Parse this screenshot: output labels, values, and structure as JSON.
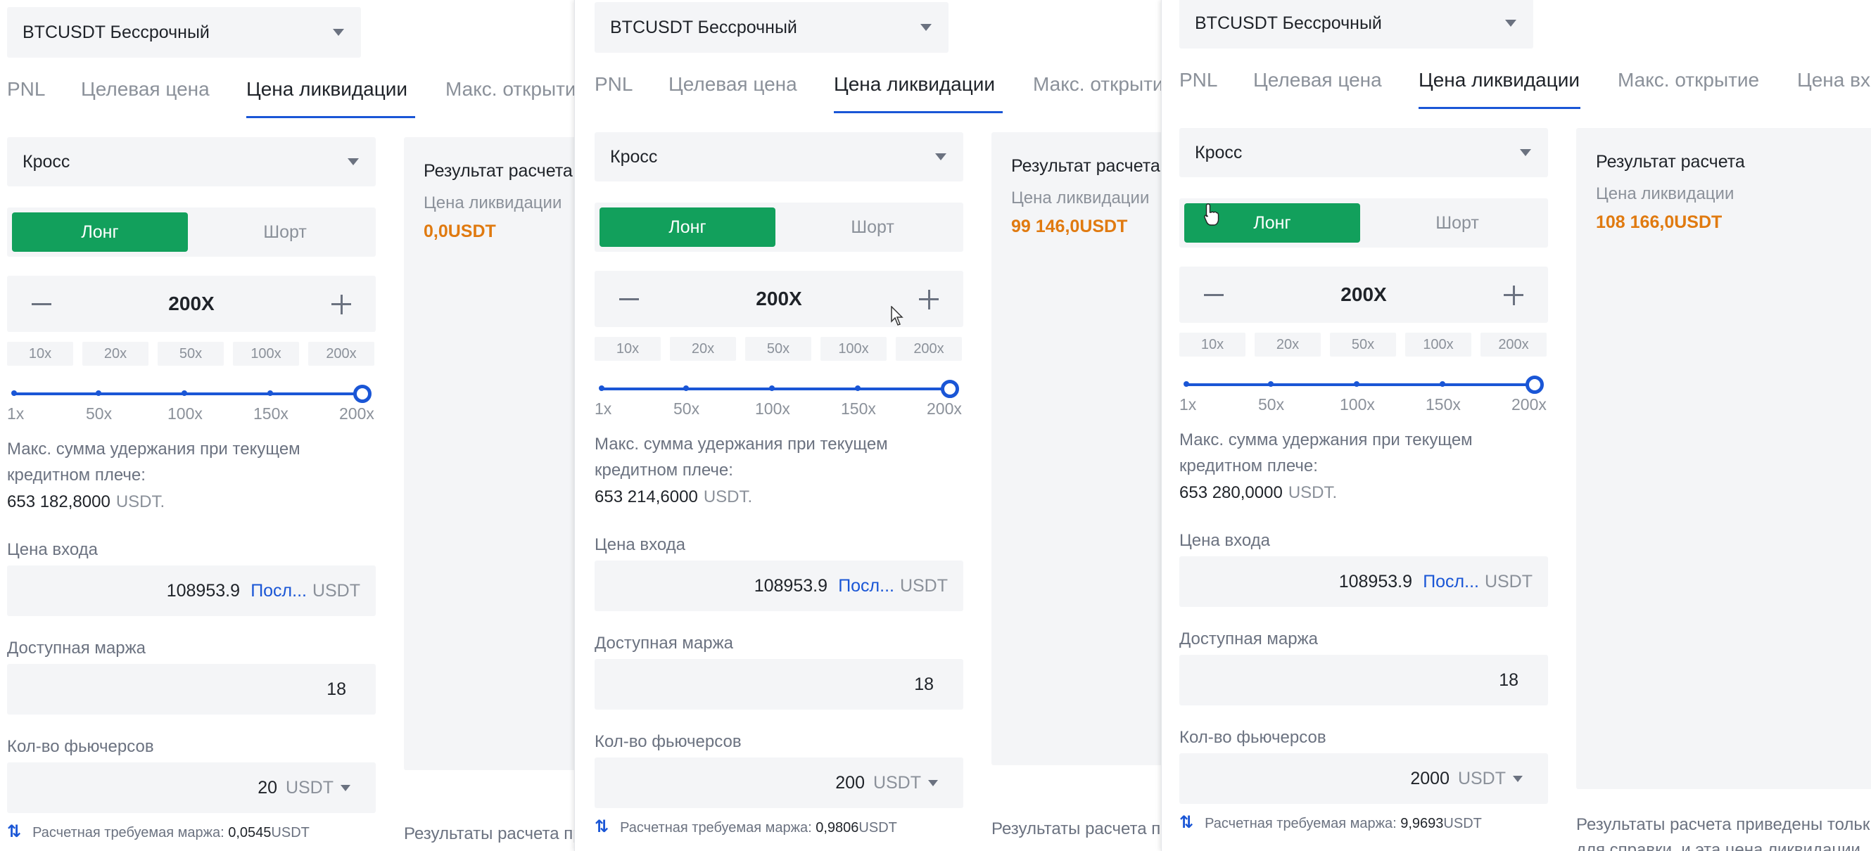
{
  "panels": [
    {
      "contract": "BTCUSDT Бессрочный",
      "tabs": [
        "PNL",
        "Целевая цена",
        "Цена ликвидации",
        "Макс. открыти"
      ],
      "active_tab": 2,
      "margin_mode": "Кросс",
      "long_label": "Лонг",
      "short_label": "Шорт",
      "leverage": "200X",
      "presets": [
        "10x",
        "20x",
        "50x",
        "100x",
        "200x"
      ],
      "slider_ticks": [
        "1x",
        "50x",
        "100x",
        "150x",
        "200x"
      ],
      "slider_value_fraction": 1.0,
      "max_hold_line1": "Макс. сумма удержания при текущем",
      "max_hold_line2": "кредитном плече:",
      "max_hold_value": "653 182,8000",
      "max_hold_unit": "USDT.",
      "entry_label": "Цена входа",
      "entry_value": "108953.9",
      "entry_last": "Посл...",
      "entry_unit": "USDT",
      "margin_label": "Доступная маржа",
      "margin_value": "18",
      "qty_label": "Кол-во фьючерсов",
      "qty_value": "20",
      "qty_unit": "USDT",
      "est_label": "Расчетная требуемая маржа:",
      "est_value": "0,0545",
      "est_unit": "USDT",
      "result_title": "Результат расчета",
      "result_label": "Цена ликвидации",
      "result_value": "0,0USDT",
      "note": "Результаты расчета пр"
    },
    {
      "contract": "BTCUSDT Бессрочный",
      "tabs": [
        "PNL",
        "Целевая цена",
        "Цена ликвидации",
        "Макс. открытие"
      ],
      "active_tab": 2,
      "margin_mode": "Кросс",
      "long_label": "Лонг",
      "short_label": "Шорт",
      "leverage": "200X",
      "presets": [
        "10x",
        "20x",
        "50x",
        "100x",
        "200x"
      ],
      "slider_ticks": [
        "1x",
        "50x",
        "100x",
        "150x",
        "200x"
      ],
      "slider_value_fraction": 1.0,
      "max_hold_line1": "Макс. сумма удержания при текущем",
      "max_hold_line2": "кредитном плече:",
      "max_hold_value": "653 214,6000",
      "max_hold_unit": "USDT.",
      "entry_label": "Цена входа",
      "entry_value": "108953.9",
      "entry_last": "Посл...",
      "entry_unit": "USDT",
      "margin_label": "Доступная маржа",
      "margin_value": "18",
      "qty_label": "Кол-во фьючерсов",
      "qty_value": "200",
      "qty_unit": "USDT",
      "est_label": "Расчетная требуемая маржа:",
      "est_value": "0,9806",
      "est_unit": "USDT",
      "result_title": "Результат расчета",
      "result_label": "Цена ликвидации",
      "result_value": "99 146,0USDT",
      "note": "Результаты расчета пр"
    },
    {
      "contract": "BTCUSDT Бессрочный",
      "tabs": [
        "PNL",
        "Целевая цена",
        "Цена ликвидации",
        "Макс. открытие",
        "Цена вх"
      ],
      "active_tab": 2,
      "margin_mode": "Кросс",
      "long_label": "Лонг",
      "short_label": "Шорт",
      "leverage": "200X",
      "presets": [
        "10x",
        "20x",
        "50x",
        "100x",
        "200x"
      ],
      "slider_ticks": [
        "1x",
        "50x",
        "100x",
        "150x",
        "200x"
      ],
      "slider_value_fraction": 1.0,
      "max_hold_line1": "Макс. сумма удержания при текущем",
      "max_hold_line2": "кредитном плече:",
      "max_hold_value": "653 280,0000",
      "max_hold_unit": "USDT.",
      "entry_label": "Цена входа",
      "entry_value": "108953.9",
      "entry_last": "Посл...",
      "entry_unit": "USDT",
      "margin_label": "Доступная маржа",
      "margin_value": "18",
      "qty_label": "Кол-во фьючерсов",
      "qty_value": "2000",
      "qty_unit": "USDT",
      "est_label": "Расчетная требуемая маржа:",
      "est_value": "9,9693",
      "est_unit": "USDT",
      "result_title": "Результат расчета",
      "result_label": "Цена ликвидации",
      "result_value": "108 166,0USDT",
      "note": "Результаты расчета приведены тольк",
      "note2": "для справки, и эта цена ликвидации"
    }
  ],
  "colors": {
    "accent": "#1a56d6",
    "long_green": "#12a05c",
    "result_orange": "#e07a10",
    "field_bg": "#f4f5f7"
  }
}
